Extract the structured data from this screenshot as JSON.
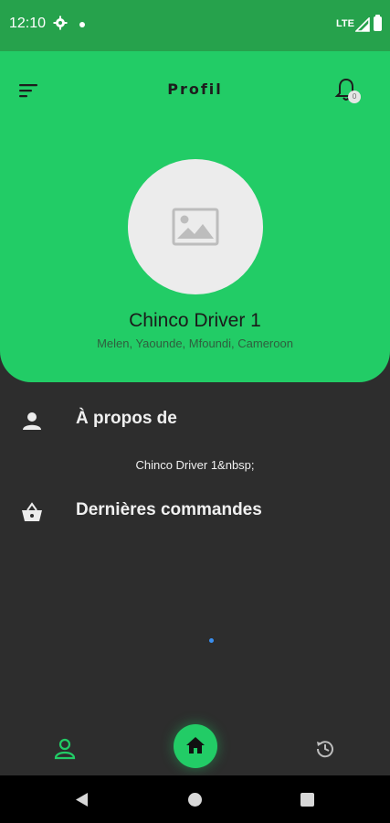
{
  "status_bar": {
    "time": "12:10",
    "network": "LTE"
  },
  "header": {
    "title": "Profil",
    "notification_count": "0"
  },
  "profile": {
    "name": "Chinco Driver 1",
    "address": "Melen, Yaounde, Mfoundi, Cameroon"
  },
  "sections": {
    "about": {
      "label": "À propos de",
      "text": "Chinco Driver 1&nbsp;"
    },
    "orders": {
      "label": "Dernières commandes"
    }
  },
  "colors": {
    "accent": "#22cc66",
    "status_bar": "#26a24c",
    "background": "#2d2d2d",
    "loader": "#3a8ff0"
  },
  "bottom_nav": {
    "items": [
      {
        "icon": "person-icon",
        "active": true
      },
      {
        "icon": "home-icon",
        "active": false
      },
      {
        "icon": "history-icon",
        "active": false
      }
    ]
  }
}
